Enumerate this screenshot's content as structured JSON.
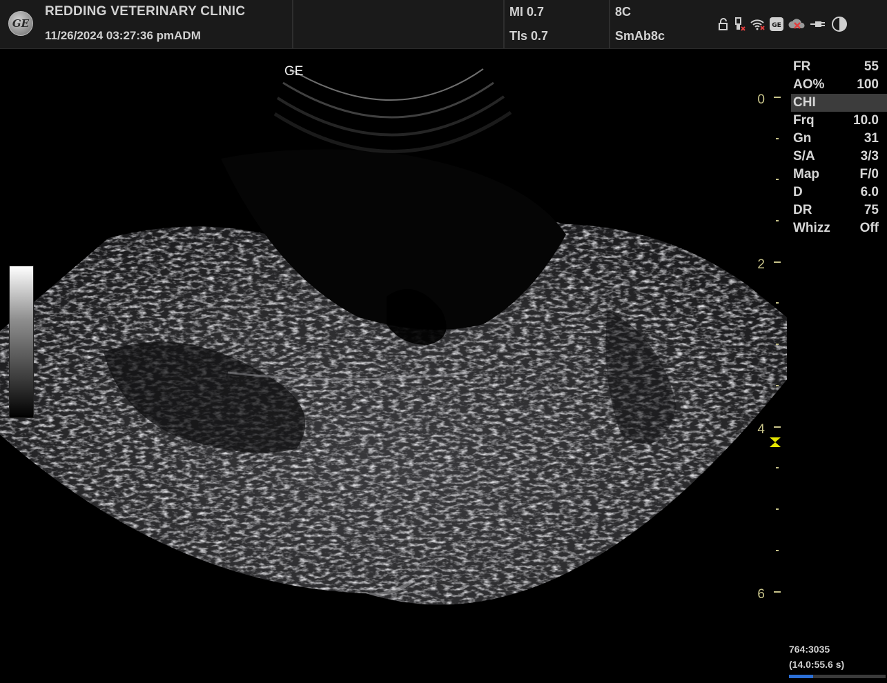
{
  "header": {
    "clinic_name": "REDDING VETERINARY CLINIC",
    "datetime": "11/26/2024 03:27:36 pmADM",
    "mi": "MI 0.7",
    "tis": "TIs 0.7",
    "probe": "8C",
    "preset": "SmAb8c",
    "logo_text": "GE",
    "status_icons": [
      "lock-icon",
      "usb-icon",
      "wifi-icon",
      "ge-service-icon",
      "network-disconnected-icon",
      "power-plug-icon",
      "half-circle-contrast-icon"
    ]
  },
  "image": {
    "orientation_marker": "GE",
    "depth_labels": [
      "0",
      "2",
      "4",
      "6"
    ],
    "colors": {
      "depth_scale": "#c8c48a",
      "focus_marker": "#e6e600",
      "cine_progress": "#2b6fd6"
    }
  },
  "params": [
    {
      "name": "FR",
      "value": "55"
    },
    {
      "name": "AO%",
      "value": "100"
    },
    {
      "name": "CHI",
      "value": "",
      "highlighted": true
    },
    {
      "name": "Frq",
      "value": "10.0"
    },
    {
      "name": "Gn",
      "value": "31"
    },
    {
      "name": "S/A",
      "value": "3/3"
    },
    {
      "name": "Map",
      "value": "F/0"
    },
    {
      "name": "D",
      "value": "6.0"
    },
    {
      "name": "DR",
      "value": "75"
    },
    {
      "name": "Whizz",
      "value": "Off"
    }
  ],
  "cine": {
    "frame_counter": "764:3035",
    "time": "(14.0:55.6 s)",
    "progress": 0.25
  }
}
